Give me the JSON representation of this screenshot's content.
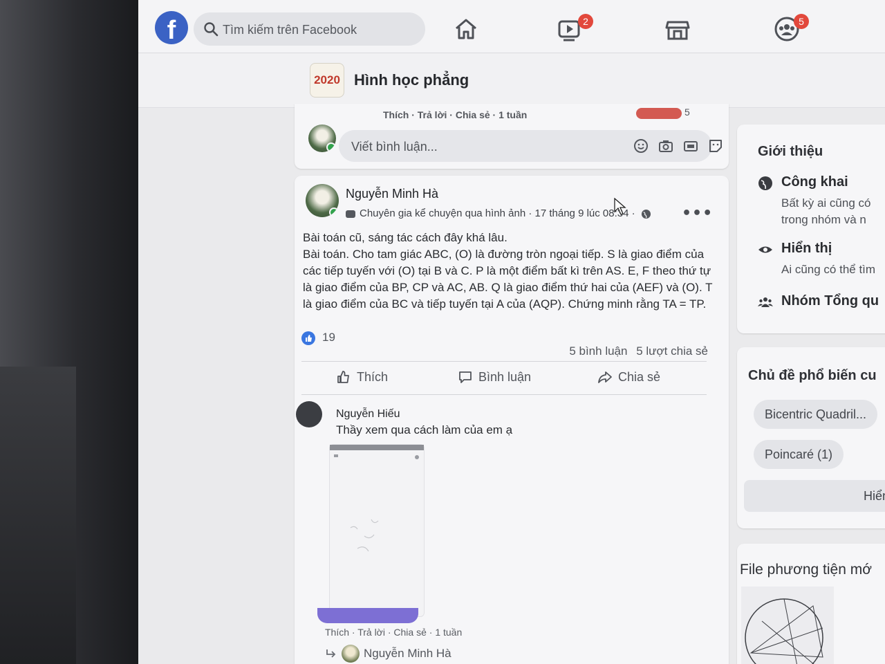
{
  "topbar": {
    "search_placeholder": "Tìm kiếm trên Facebook",
    "logo_letter": "f",
    "badges": {
      "watch": "2",
      "groups": "5"
    }
  },
  "group": {
    "name": "Hình học phẳng",
    "thumb_text": "2020"
  },
  "prev_comment": {
    "meta": "Thích · Trả lời · Chia sẻ · 1 tuần",
    "reaction_count": "5",
    "write_placeholder": "Viết bình luận..."
  },
  "post": {
    "author": "Nguyễn Minh Hà",
    "subtitle": "Chuyên gia kể chuyện qua hình ảnh · 17 tháng 9 lúc 08:34 ·",
    "body": [
      "Bài toán cũ, sáng tác cách đây khá lâu.",
      "Bài toán. Cho tam giác ABC, (O) là đường tròn ngoại tiếp. S là giao điểm của các tiếp tuyến với (O) tại B và C. P là một điểm bất kì trên AS. E, F theo thứ tự là giao điểm của BP, CP và AC, AB. Q là giao điểm thứ hai của (AEF) và (O). T là giao điểm của BC và tiếp tuyến tại A của (AQP). Chứng minh rằng TA = TP."
    ],
    "likes": "19",
    "comments_count": "5 bình luận",
    "shares_count": "5 lượt chia sẻ",
    "actions": {
      "like": "Thích",
      "comment": "Bình luận",
      "share": "Chia sẻ"
    },
    "comment": {
      "author": "Nguyễn Hiếu",
      "text": "Thầy xem qua cách làm của em ạ",
      "meta": "Thích · Trả lời · Chia sẻ · 1 tuần",
      "reply_author": "Nguyễn Minh Hà"
    }
  },
  "sidebar": {
    "about": {
      "title": "Giới thiệu",
      "items": [
        {
          "title": "Công khai",
          "text_1": "Bất kỳ ai cũng có",
          "text_2": "trong nhóm và n"
        },
        {
          "title": "Hiển thị",
          "text_1": "Ai cũng có thể tìm"
        },
        {
          "title": "Nhóm Tổng qu"
        }
      ]
    },
    "topics": {
      "title": "Chủ đề phổ biến cu",
      "chips": [
        "Bicentric Quadril...",
        "Poincaré (1)"
      ],
      "show_more": "Hiển th"
    },
    "media": {
      "title": "File phương tiện mớ"
    }
  },
  "colors": {
    "brand": "#3b62c4",
    "badge": "#e2483c",
    "online": "#31a24c"
  }
}
